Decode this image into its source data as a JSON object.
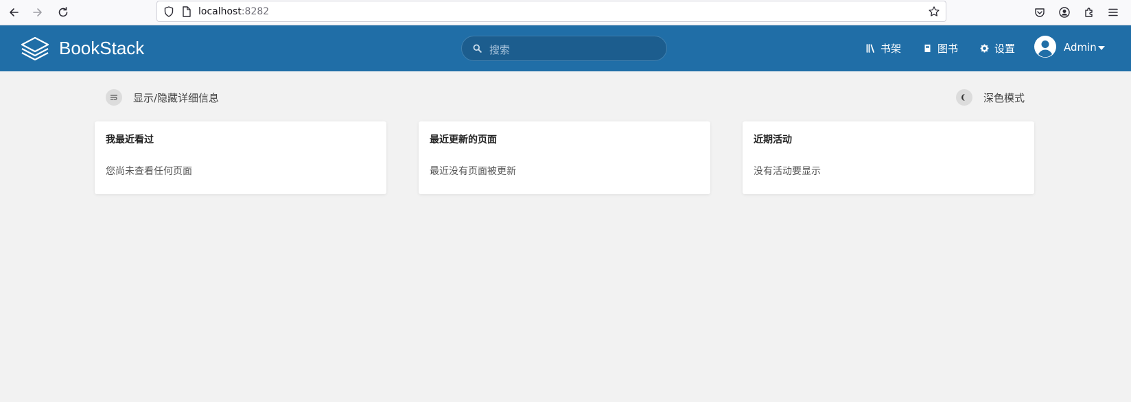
{
  "browser": {
    "url_host": "localhost",
    "url_port": ":8282"
  },
  "header": {
    "brand": "BookStack",
    "search_placeholder": "搜索",
    "nav": {
      "shelves": "书架",
      "books": "图书",
      "settings": "设置"
    },
    "user": "Admin"
  },
  "toolbar": {
    "toggle_details": "显示/隐藏详细信息",
    "dark_mode": "深色模式"
  },
  "cards": [
    {
      "title": "我最近看过",
      "body": "您尚未查看任何页面"
    },
    {
      "title": "最近更新的页面",
      "body": "最近没有页面被更新"
    },
    {
      "title": "近期活动",
      "body": "没有活动要显示"
    }
  ],
  "colors": {
    "header_bg": "#206ea7",
    "page_bg": "#f2f2f2",
    "card_bg": "#ffffff"
  }
}
